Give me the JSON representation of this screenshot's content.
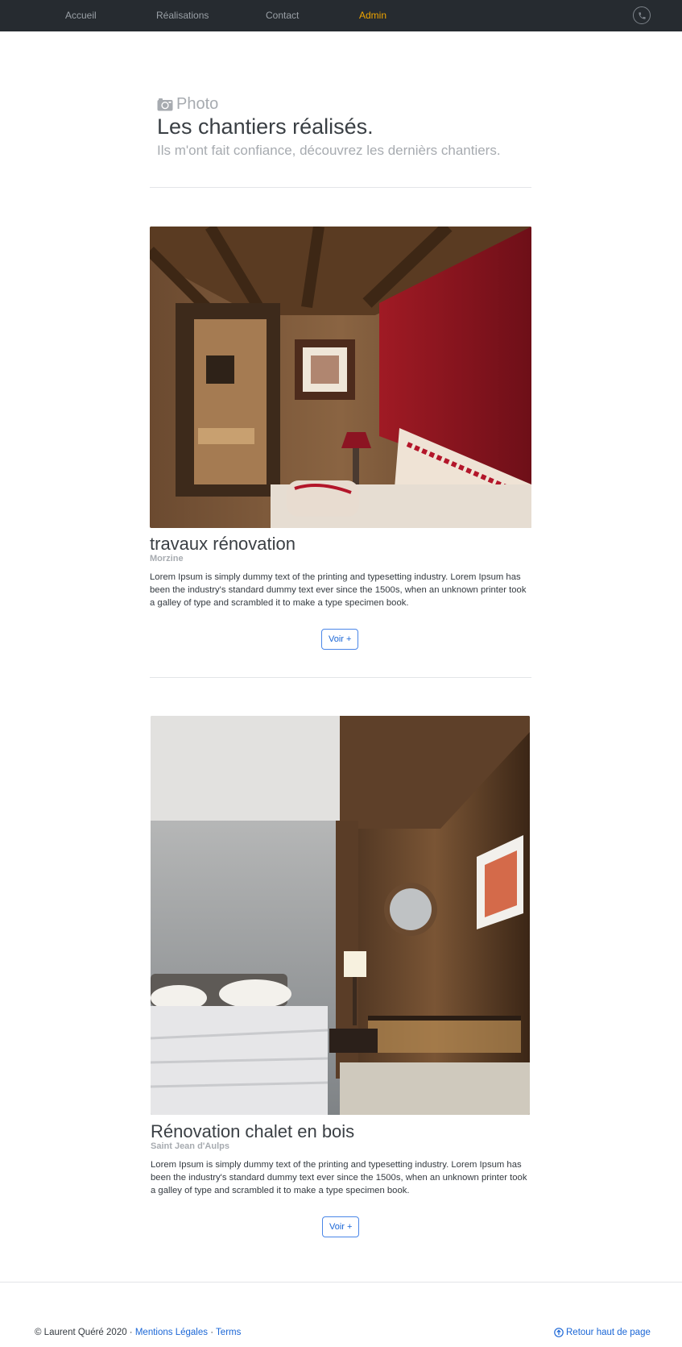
{
  "nav": {
    "items": [
      {
        "label": "Accueil",
        "active": false
      },
      {
        "label": "Réalisations",
        "active": false
      },
      {
        "label": "Contact",
        "active": false
      },
      {
        "label": "Admin",
        "active": true
      }
    ],
    "phone_icon": "phone-icon",
    "background": "#262b30",
    "active_color": "#f0a500"
  },
  "header": {
    "photo_icon": "camera-icon",
    "photo_label": "Photo",
    "title": "Les chantiers réalisés.",
    "subtitle": "Ils m'ont fait confiance, découvrez les dernièrs chantiers."
  },
  "projects": [
    {
      "title": "travaux rénovation",
      "location": "Morzine",
      "description": "Lorem Ipsum is simply dummy text of the printing and typesetting industry. Lorem Ipsum has been the industry's standard dummy text ever since the 1500s, when an unknown printer took a galley of type and scrambled it to make a type specimen book.",
      "button_label": "Voir +"
    },
    {
      "title": "Rénovation chalet en bois",
      "location": "Saint Jean d'Aulps",
      "description": "Lorem Ipsum is simply dummy text of the printing and typesetting industry. Lorem Ipsum has been the industry's standard dummy text ever since the 1500s, when an unknown printer took a galley of type and scrambled it to make a type specimen book.",
      "button_label": "Voir +"
    }
  ],
  "footer": {
    "copyright": "© Laurent Quéré 2020 ·",
    "legal_link": "Mentions Légales",
    "separator": "·",
    "terms_link": "Terms",
    "back_to_top": "Retour haut de page",
    "back_to_top_icon": "arrow-up-circle-icon"
  },
  "colors": {
    "accent": "#1a66d6",
    "muted": "#a7abb0"
  }
}
